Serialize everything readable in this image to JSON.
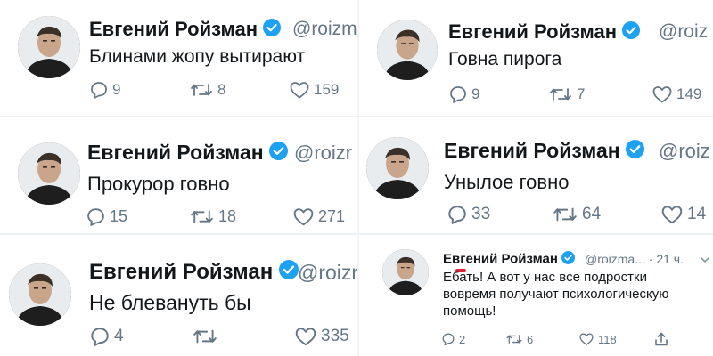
{
  "tweets": [
    {
      "name": "Евгений Ройзман",
      "handle": "@roizm",
      "text": "Блинами жопу вытирают",
      "replies": "9",
      "retweets": "8",
      "likes": "159"
    },
    {
      "name": "Евгений Ройзман",
      "handle": "@roiz",
      "text": "Говна пирога",
      "replies": "9",
      "retweets": "7",
      "likes": "149"
    },
    {
      "name": "Евгений Ройзман",
      "handle": "@roizr",
      "text": "Прокурор говно",
      "replies": "15",
      "retweets": "18",
      "likes": "271"
    },
    {
      "name": "Евгений Ройзман",
      "handle": "@roiz",
      "text": "Унылое говно",
      "replies": "33",
      "retweets": "64",
      "likes": "14"
    },
    {
      "name": "Евгений Ройзман",
      "handle": "@roizr",
      "text": "Не блевануть бы",
      "replies": "4",
      "retweets": "",
      "likes": "335"
    },
    {
      "name": "Евгений Ройзман",
      "handle": "@roizma...",
      "time": "· 21 ч.",
      "text": "Ебать! А вот у нас все подростки вовремя получают психологическую помощь!",
      "replies": "2",
      "retweets": "6",
      "likes": "118"
    }
  ],
  "colors": {
    "verified": "#1da1f2",
    "muted": "#657786",
    "text": "#14171a",
    "mark": "#d0021b"
  },
  "icons": [
    "avatar",
    "verified-badge-icon",
    "reply-icon",
    "retweet-icon",
    "like-icon",
    "share-icon",
    "caret-icon"
  ]
}
